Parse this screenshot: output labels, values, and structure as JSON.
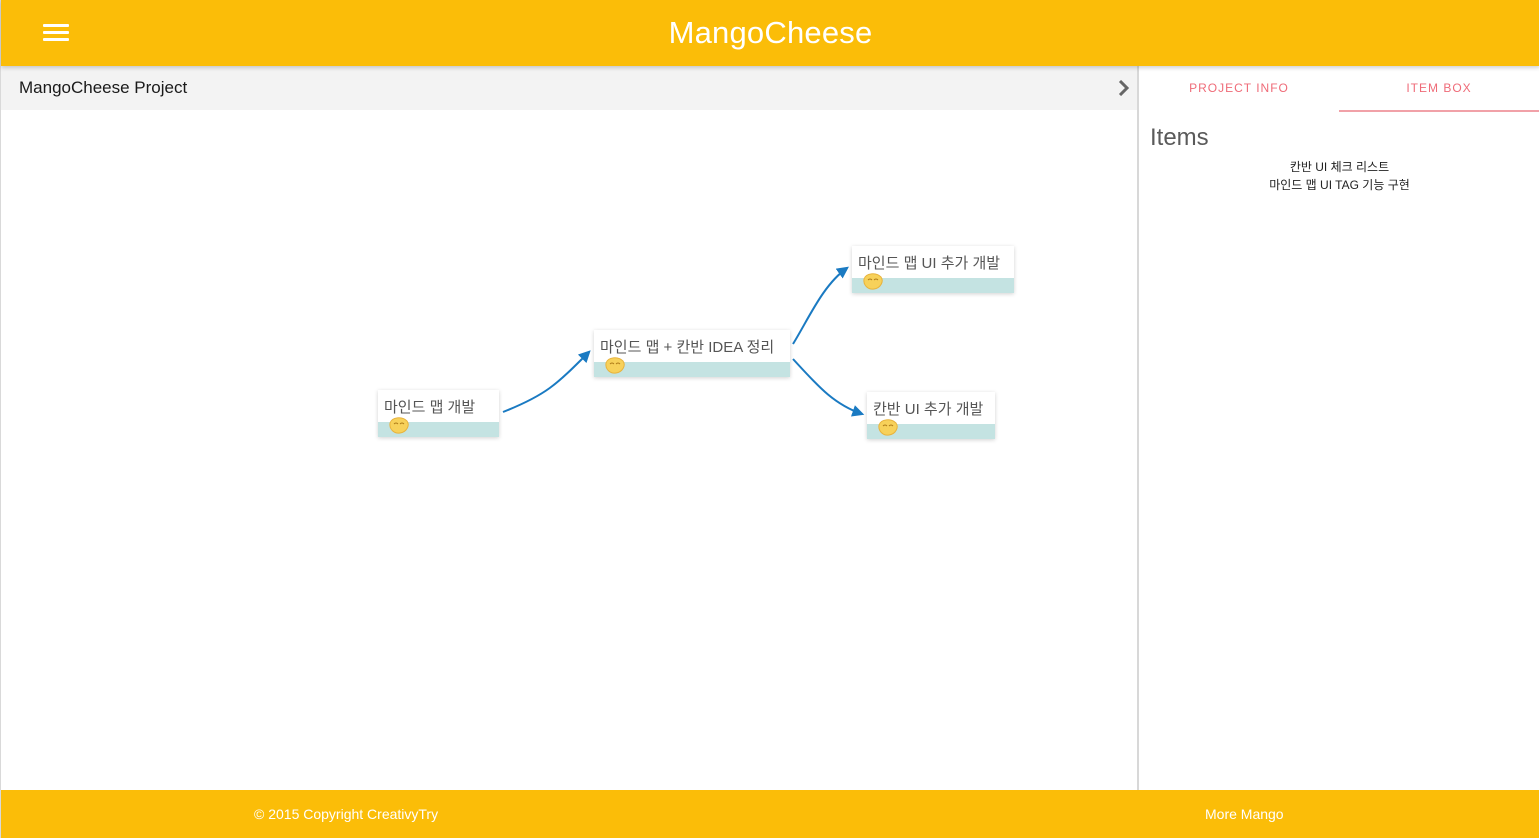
{
  "header": {
    "title": "MangoCheese",
    "menu_icon": "hamburger-menu-icon"
  },
  "project": {
    "name": "MangoCheese Project",
    "expand_icon": "chevron-right-icon"
  },
  "mindmap": {
    "nodes": [
      {
        "label": "마인드 맵 개발",
        "icon": "mango-icon"
      },
      {
        "label": "마인드 맵 + 칸반 IDEA 정리",
        "icon": "mango-icon"
      },
      {
        "label": "마인드 맵 UI 추가 개발",
        "icon": "mango-icon"
      },
      {
        "label": "칸반 UI 추가 개발",
        "icon": "mango-icon"
      }
    ],
    "edge_color": "#1a7ac2",
    "strip_color": "#c4e3e2"
  },
  "panel": {
    "tabs": [
      {
        "label": "PROJECT INFO",
        "active": false
      },
      {
        "label": "ITEM BOX",
        "active": true
      }
    ],
    "items_title": "Items",
    "items": [
      "칸반 UI 체크 리스트",
      "마인드 맵 UI TAG 기능 구현"
    ]
  },
  "footer": {
    "copyright": "© 2015 Copyright CreativyTry",
    "more_link": "More Mango"
  },
  "colors": {
    "brand": "#fbbd08",
    "tab_text": "#ef6b78"
  }
}
